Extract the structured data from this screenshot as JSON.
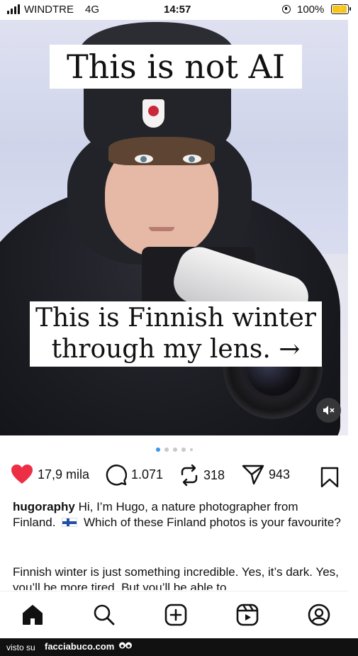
{
  "status_bar": {
    "carrier": "WINDTRE",
    "network": "4G",
    "time": "14:57",
    "battery_percent": "100%",
    "battery_level": 1.0,
    "battery_color": "#f5c518"
  },
  "post": {
    "image_text_top": "This is not AI",
    "image_text_bottom": "This is Finnish winter through my lens. →",
    "carousel": {
      "total_dots": 5,
      "active_index": 0,
      "active_color": "#3897f0"
    },
    "likes": "17,9 mila",
    "comments": "1.071",
    "reposts": "318",
    "shares": "943",
    "like_color": "#ed2f45",
    "username": "hugoraphy",
    "caption_part1": "Hi, I’m Hugo, a nature photographer from Finland.",
    "caption_part2": "Which of these Finland photos is your favourite?",
    "caption_more": "Finnish winter is just something incredible. Yes, it’s dark. Yes, you’ll be more tired. But you’ll be able to"
  },
  "icons": {
    "like": "heart-icon",
    "comment": "comment-icon",
    "repost": "repost-icon",
    "share": "send-icon",
    "save": "bookmark-icon",
    "mute": "mute-icon",
    "nav": [
      "home-icon",
      "search-icon",
      "create-icon",
      "reels-icon",
      "profile-icon"
    ]
  },
  "footer": {
    "visto_su": "visto su",
    "brand": "facciabuco.com"
  }
}
